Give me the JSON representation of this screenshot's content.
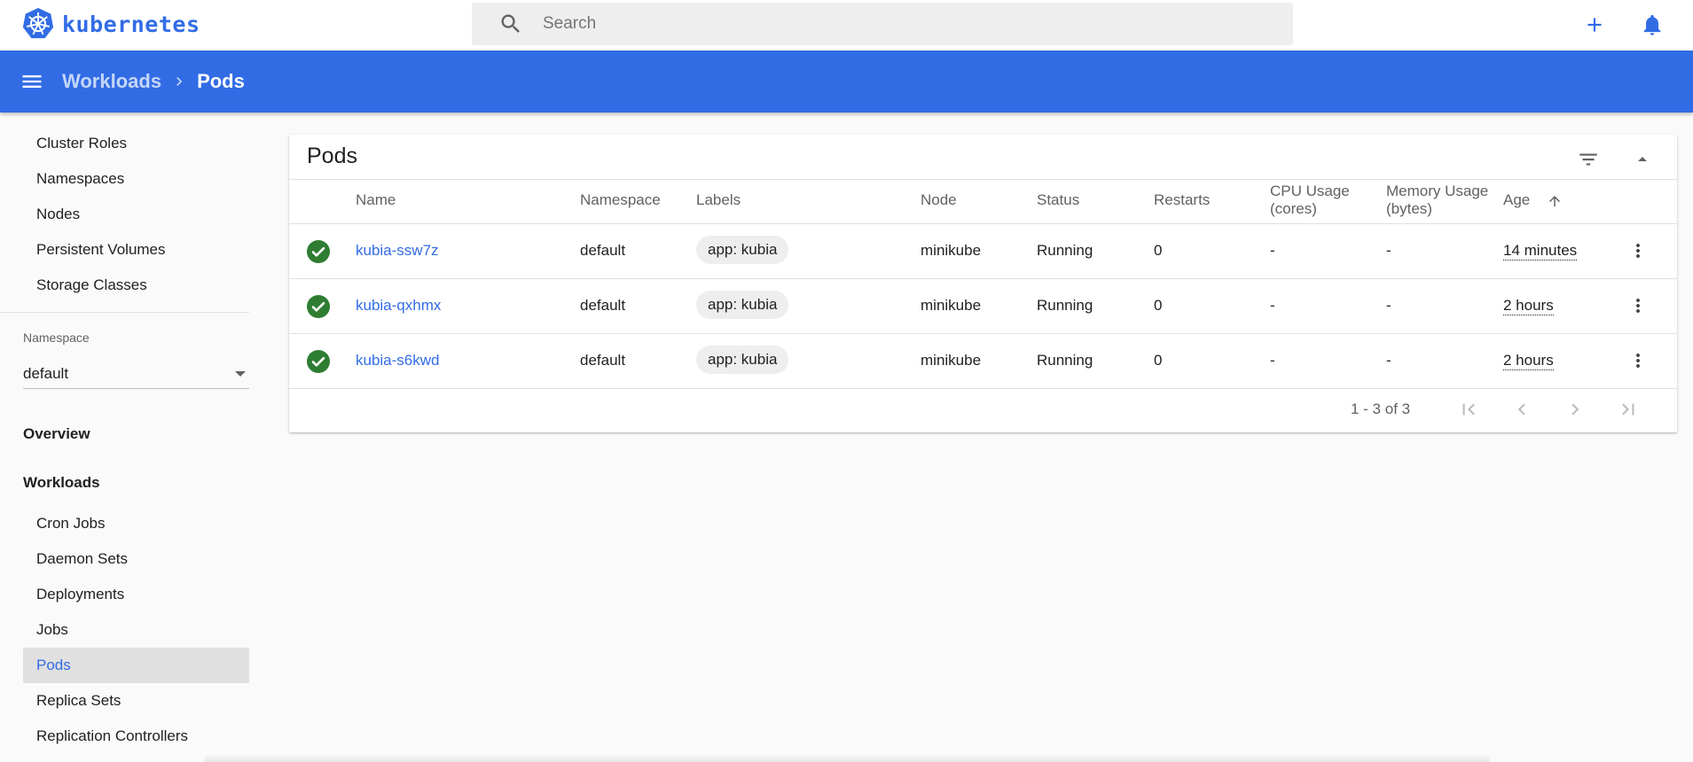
{
  "app": {
    "brand": "kubernetes",
    "accent_color": "#326ce5"
  },
  "topbar": {
    "search_placeholder": "Search",
    "icons": [
      "kubernetes-logo-icon",
      "search-icon",
      "plus-icon",
      "bell-icon"
    ]
  },
  "breadcrumb": {
    "parent": "Workloads",
    "current": "Pods"
  },
  "sidebar": {
    "top_items": [
      {
        "label": "Cluster Roles"
      },
      {
        "label": "Namespaces"
      },
      {
        "label": "Nodes"
      },
      {
        "label": "Persistent Volumes"
      },
      {
        "label": "Storage Classes"
      }
    ],
    "namespace_label": "Namespace",
    "namespace_value": "default",
    "overview": "Overview",
    "workloads": "Workloads",
    "workload_items": [
      {
        "label": "Cron Jobs"
      },
      {
        "label": "Daemon Sets"
      },
      {
        "label": "Deployments"
      },
      {
        "label": "Jobs"
      },
      {
        "label": "Pods",
        "active": true
      },
      {
        "label": "Replica Sets"
      },
      {
        "label": "Replication Controllers"
      }
    ]
  },
  "card": {
    "title": "Pods",
    "columns": [
      "Name",
      "Namespace",
      "Labels",
      "Node",
      "Status",
      "Restarts",
      "CPU Usage (cores)",
      "Memory Usage (bytes)",
      "Age"
    ],
    "sorted_column": "Age",
    "sort_direction": "ascending",
    "rows": [
      {
        "name": "kubia-ssw7z",
        "namespace": "default",
        "label": "app: kubia",
        "node": "minikube",
        "status": "Running",
        "restarts": "0",
        "cpu": "-",
        "memory": "-",
        "age": "14 minutes",
        "status_color": "#2e7d32"
      },
      {
        "name": "kubia-qxhmx",
        "namespace": "default",
        "label": "app: kubia",
        "node": "minikube",
        "status": "Running",
        "restarts": "0",
        "cpu": "-",
        "memory": "-",
        "age": "2 hours",
        "status_color": "#2e7d32"
      },
      {
        "name": "kubia-s6kwd",
        "namespace": "default",
        "label": "app: kubia",
        "node": "minikube",
        "status": "Running",
        "restarts": "0",
        "cpu": "-",
        "memory": "-",
        "age": "2 hours",
        "status_color": "#2e7d32"
      }
    ],
    "pagination": {
      "range": "1 - 3 of 3"
    }
  }
}
